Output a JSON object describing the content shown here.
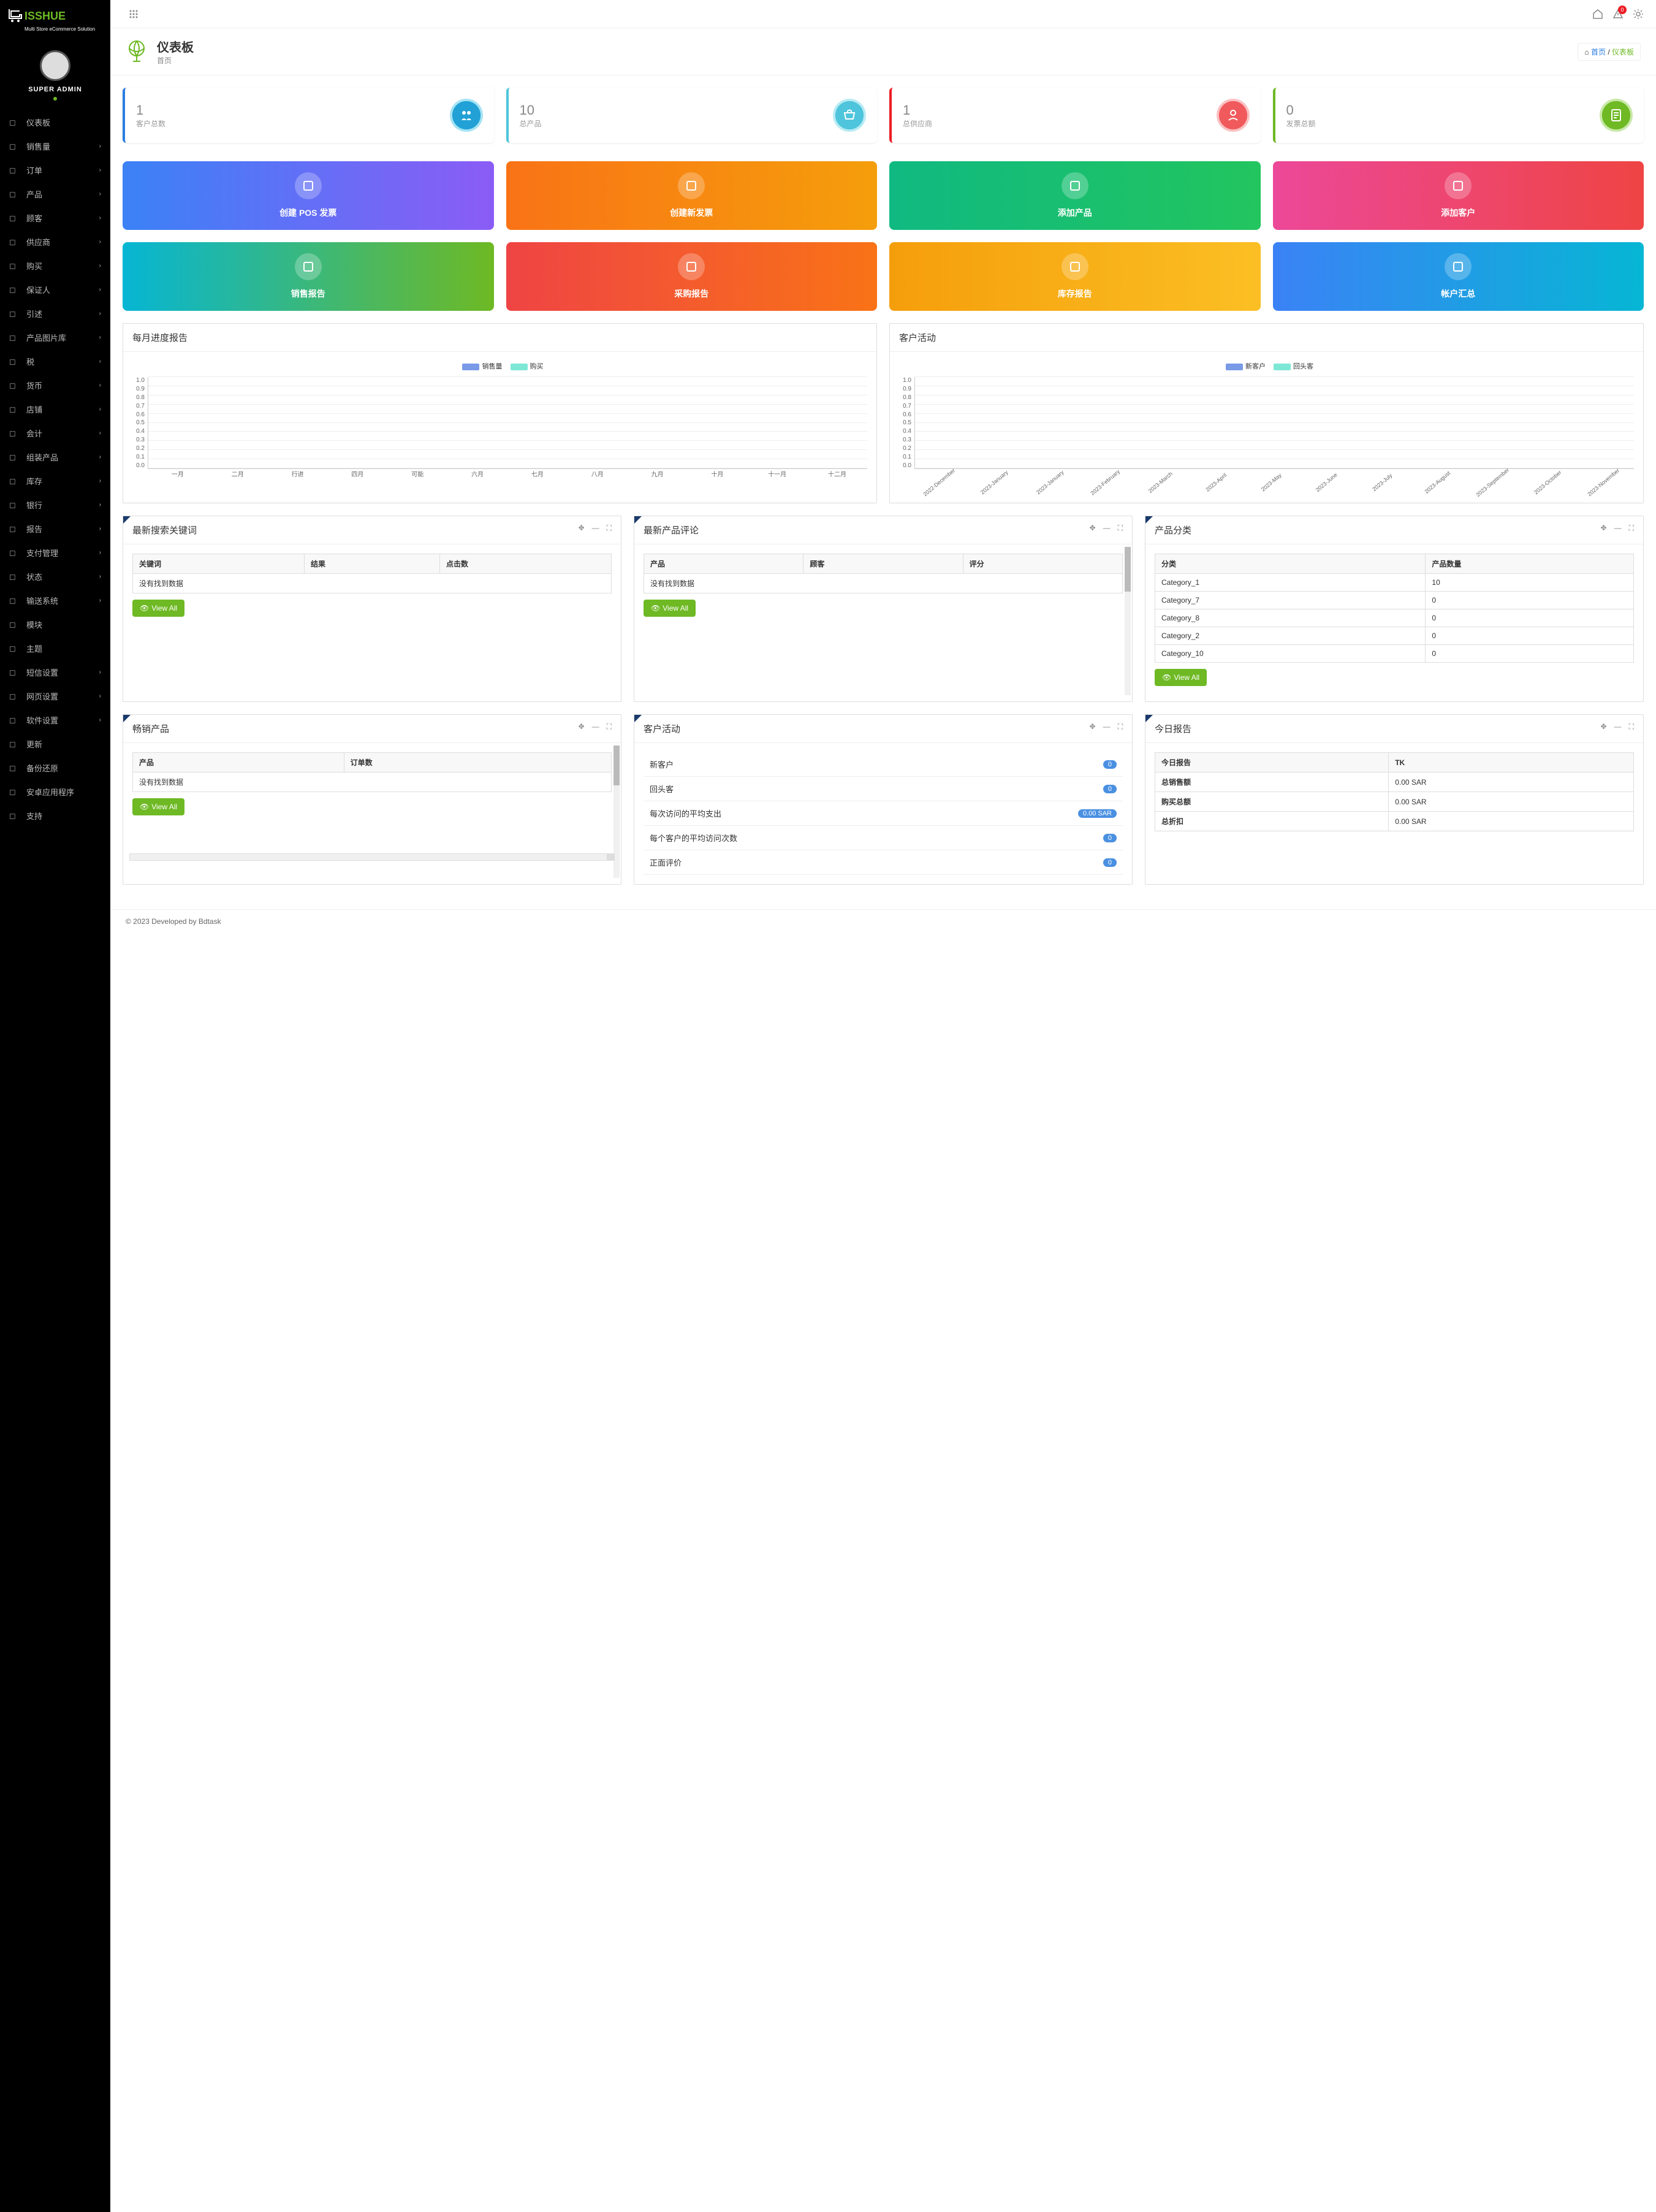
{
  "logo": {
    "main": "ISSHUE",
    "sub": "Multi Store eCommerce Solution"
  },
  "user": {
    "name": "SUPER ADMIN",
    "avatar_alt": ""
  },
  "notif_count": "0",
  "page": {
    "title": "仪表板",
    "sub": "首页"
  },
  "breadcrumb": {
    "home": "首页",
    "current": "仪表板"
  },
  "nav": [
    {
      "label": "仪表板",
      "expandable": false
    },
    {
      "label": "销售量",
      "expandable": true
    },
    {
      "label": "订单",
      "expandable": true
    },
    {
      "label": "产品",
      "expandable": true
    },
    {
      "label": "顾客",
      "expandable": true
    },
    {
      "label": "供应商",
      "expandable": true
    },
    {
      "label": "购买",
      "expandable": true
    },
    {
      "label": "保证人",
      "expandable": true
    },
    {
      "label": "引述",
      "expandable": true
    },
    {
      "label": "产品图片库",
      "expandable": true
    },
    {
      "label": "税",
      "expandable": true
    },
    {
      "label": "货币",
      "expandable": true
    },
    {
      "label": "店铺",
      "expandable": true
    },
    {
      "label": "会计",
      "expandable": true
    },
    {
      "label": "组装产品",
      "expandable": true
    },
    {
      "label": "库存",
      "expandable": true
    },
    {
      "label": "银行",
      "expandable": true
    },
    {
      "label": "报告",
      "expandable": true
    },
    {
      "label": "支付管理",
      "expandable": true
    },
    {
      "label": "状态",
      "expandable": true
    },
    {
      "label": "输送系统",
      "expandable": true
    },
    {
      "label": "模块",
      "expandable": false
    },
    {
      "label": "主题",
      "expandable": false
    },
    {
      "label": "短信设置",
      "expandable": true
    },
    {
      "label": "网页设置",
      "expandable": true
    },
    {
      "label": "软件设置",
      "expandable": true
    },
    {
      "label": "更新",
      "expandable": false
    },
    {
      "label": "备份还原",
      "expandable": false
    },
    {
      "label": "安卓应用程序",
      "expandable": false
    },
    {
      "label": "支持",
      "expandable": false
    }
  ],
  "stats": [
    {
      "value": "1",
      "label": "客户总数"
    },
    {
      "value": "10",
      "label": "总产品"
    },
    {
      "value": "1",
      "label": "总供应商"
    },
    {
      "value": "0",
      "label": "发票总额"
    }
  ],
  "actions1": [
    {
      "label": "创建 POS 发票",
      "cls": "g-blue"
    },
    {
      "label": "创建新发票",
      "cls": "g-orange"
    },
    {
      "label": "添加产品",
      "cls": "g-green"
    },
    {
      "label": "添加客户",
      "cls": "g-pink"
    }
  ],
  "actions2": [
    {
      "label": "销售报告",
      "cls": "g-teal"
    },
    {
      "label": "采购报告",
      "cls": "g-red"
    },
    {
      "label": "库存报告",
      "cls": "g-amber"
    },
    {
      "label": "帐户汇总",
      "cls": "g-sky"
    }
  ],
  "chart1": {
    "title": "每月进度报告",
    "legend1": "销售量",
    "legend2": "购买"
  },
  "chart2": {
    "title": "客户活动",
    "legend1": "新客户",
    "legend2": "回头客"
  },
  "panels": {
    "keywords": {
      "title": "最新搜索关键词",
      "cols": [
        "关键词",
        "结果",
        "点击数"
      ],
      "empty": "没有找到数据",
      "view": "View All"
    },
    "reviews": {
      "title": "最新产品评论",
      "cols": [
        "产品",
        "顾客",
        "评分"
      ],
      "empty": "没有找到数据",
      "view": "View All"
    },
    "categories": {
      "title": "产品分类",
      "cols": [
        "分类",
        "产品数量"
      ],
      "rows": [
        [
          "Category_1",
          "10"
        ],
        [
          "Category_7",
          "0"
        ],
        [
          "Category_8",
          "0"
        ],
        [
          "Category_2",
          "0"
        ],
        [
          "Category_10",
          "0"
        ]
      ],
      "view": "View All"
    },
    "best": {
      "title": "畅销产品",
      "cols": [
        "产品",
        "订单数"
      ],
      "empty": "没有找到数据",
      "view": "View All"
    },
    "activity": {
      "title": "客户活动",
      "items": [
        {
          "label": "新客户",
          "badge": "0"
        },
        {
          "label": "回头客",
          "badge": "0"
        },
        {
          "label": "每次访问的平均支出",
          "badge": "0.00 SAR"
        },
        {
          "label": "每个客户的平均访问次数",
          "badge": "0"
        },
        {
          "label": "正面评价",
          "badge": "0"
        }
      ]
    },
    "today": {
      "title": "今日报告",
      "rows": [
        [
          "今日报告",
          "TK"
        ],
        [
          "总销售额",
          "0.00 SAR"
        ],
        [
          "购买总额",
          "0.00 SAR"
        ],
        [
          "总折扣",
          "0.00 SAR"
        ]
      ]
    }
  },
  "footer": "© 2023 Developed by Bdtask",
  "chart_data": [
    {
      "type": "bar",
      "title": "每月进度报告",
      "categories": [
        "一月",
        "二月",
        "行进",
        "四月",
        "可能",
        "六月",
        "七月",
        "八月",
        "九月",
        "十月",
        "十一月",
        "十二月"
      ],
      "series": [
        {
          "name": "销售量",
          "values": [
            0,
            0,
            0,
            0,
            0,
            0,
            0,
            0,
            0,
            0,
            0,
            0
          ]
        },
        {
          "name": "购买",
          "values": [
            0,
            0,
            0,
            0,
            0,
            0,
            0,
            0,
            0,
            0,
            0,
            0
          ]
        }
      ],
      "ylim": [
        0,
        1
      ],
      "yticks": [
        0,
        0.1,
        0.2,
        0.3,
        0.4,
        0.5,
        0.6,
        0.7,
        0.8,
        0.9,
        1.0
      ]
    },
    {
      "type": "bar",
      "title": "客户活动",
      "categories": [
        "2022-December",
        "2023-January",
        "2023-January",
        "2023-February",
        "2023-March",
        "2023-April",
        "2023-May",
        "2023-June",
        "2023-July",
        "2023-August",
        "2023-September",
        "2023-October",
        "2023-November"
      ],
      "series": [
        {
          "name": "新客户",
          "values": [
            0,
            0,
            0,
            0,
            0,
            0,
            0,
            0,
            0,
            0,
            0,
            0,
            0
          ]
        },
        {
          "name": "回头客",
          "values": [
            0,
            0,
            0,
            0,
            0,
            0,
            0,
            0,
            0,
            0,
            0,
            0,
            0
          ]
        }
      ],
      "ylim": [
        0,
        1
      ],
      "yticks": [
        0,
        0.1,
        0.2,
        0.3,
        0.4,
        0.5,
        0.6,
        0.7,
        0.8,
        0.9,
        1.0
      ]
    }
  ]
}
